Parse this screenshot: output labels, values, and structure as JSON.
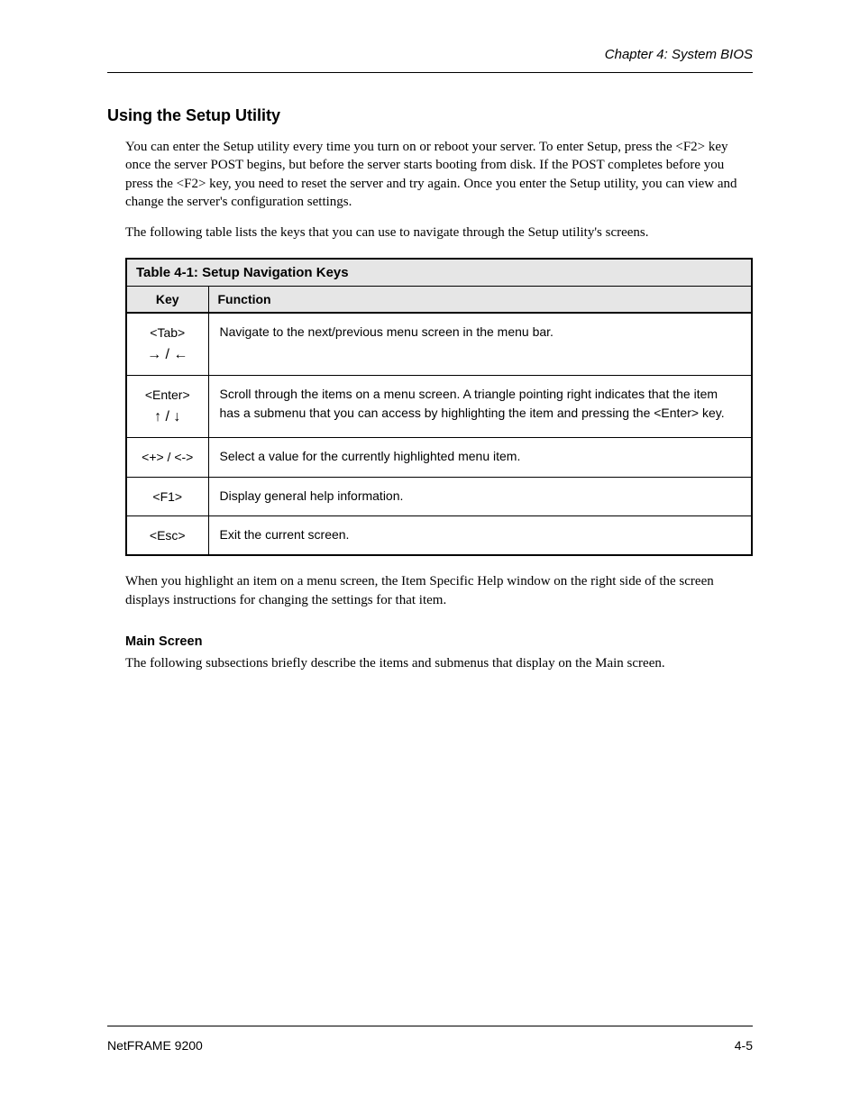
{
  "header": {
    "right": "Chapter 4: System BIOS"
  },
  "footer": {
    "left": "NetFRAME 9200",
    "right": "4-5"
  },
  "section": {
    "title": "Using the Setup Utility",
    "para1": "You can enter the Setup utility every time you turn on or reboot your server. To enter Setup, press the <F2> key once the server POST begins, but before the server starts booting from disk. If the POST completes before you press the <F2> key, you need to reset the server and try again. Once you enter the Setup utility, you can view and change the server's configuration settings.",
    "para2": "The following table lists the keys that you can use to navigate through the Setup utility's screens."
  },
  "table": {
    "title": "Table 4-1: Setup Navigation Keys",
    "col1": "Key",
    "col2": "Function",
    "rows": [
      {
        "keys": [
          "<Tab>",
          "→ / ←"
        ],
        "func": "Navigate to the next/previous menu screen in the menu bar."
      },
      {
        "keys": [
          "<Enter>",
          "↑ / ↓"
        ],
        "func": "Scroll through the items on a menu screen. A triangle pointing right indicates that the item has a submenu that you can access by highlighting the item and pressing the <Enter> key."
      },
      {
        "keys": [
          "<+> / <->"
        ],
        "func": "Select a value for the currently highlighted menu item."
      },
      {
        "keys": [
          "<F1>"
        ],
        "func": "Display general help information."
      },
      {
        "keys": [
          "<Esc>"
        ],
        "func": "Exit the current screen."
      }
    ]
  },
  "after": {
    "para": "When you highlight an item on a menu screen, the Item Specific Help window on the right side of the screen displays instructions for changing the settings for that item.",
    "subheading": "Main Screen",
    "para2": "The following subsections briefly describe the items and submenus that display on the Main screen."
  }
}
